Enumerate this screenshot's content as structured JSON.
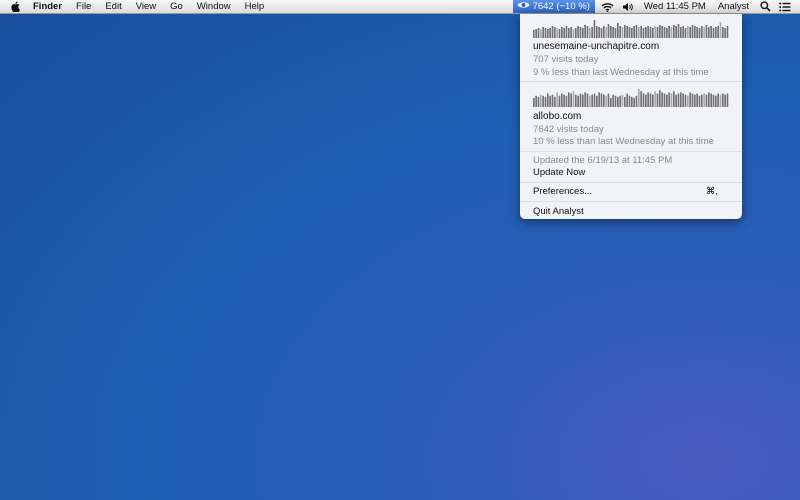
{
  "menubar": {
    "app_name": "Finder",
    "menus": [
      "File",
      "Edit",
      "View",
      "Go",
      "Window",
      "Help"
    ],
    "status_item": {
      "icon": "eye-icon",
      "label": "7642 (−10 %)"
    },
    "clock": "Wed 11:45 PM",
    "user": "Analyst"
  },
  "dropdown": {
    "sites": [
      {
        "name": "unesemaine-unchapitre.com",
        "visits": "707 visits today",
        "comparison": "9 % less than last Wednesday at this time",
        "sparkline": [
          8,
          9,
          10,
          9,
          11,
          10,
          9,
          10,
          12,
          11,
          10,
          9,
          11,
          10,
          12,
          10,
          11,
          9,
          10,
          12,
          11,
          10,
          13,
          12,
          10,
          11,
          18,
          12,
          11,
          10,
          12,
          11,
          14,
          12,
          11,
          10,
          15,
          12,
          11,
          13,
          12,
          11,
          10,
          12,
          13,
          11,
          12,
          10,
          11,
          12,
          11,
          10,
          12,
          11,
          13,
          12,
          11,
          10,
          12,
          11,
          13,
          12,
          14,
          11,
          12,
          10,
          12,
          11,
          13,
          12,
          11,
          10,
          12,
          11,
          13,
          11,
          12,
          10,
          11,
          12,
          16,
          11,
          10,
          12
        ]
      },
      {
        "name": "allobo.com",
        "visits": "7642 visits today",
        "comparison": "10 % less than last Wednesday at this time",
        "sparkline": [
          8,
          10,
          9,
          11,
          10,
          9,
          12,
          10,
          11,
          9,
          13,
          10,
          12,
          11,
          10,
          13,
          12,
          14,
          11,
          10,
          12,
          11,
          13,
          12,
          10,
          11,
          12,
          10,
          13,
          12,
          11,
          10,
          12,
          8,
          11,
          10,
          9,
          10,
          11,
          9,
          12,
          10,
          9,
          8,
          10,
          16,
          14,
          12,
          11,
          13,
          12,
          11,
          14,
          12,
          15,
          13,
          12,
          11,
          13,
          12,
          14,
          11,
          12,
          13,
          12,
          11,
          10,
          13,
          12,
          11,
          12,
          10,
          11,
          12,
          11,
          13,
          12,
          11,
          10,
          12,
          11,
          12,
          11,
          12
        ]
      }
    ],
    "updated": "Updated the 6/19/13 at 11:45 PM",
    "update_now": "Update Now",
    "preferences": "Preferences...",
    "preferences_shortcut": "⌘,",
    "quit": "Quit Analyst"
  }
}
